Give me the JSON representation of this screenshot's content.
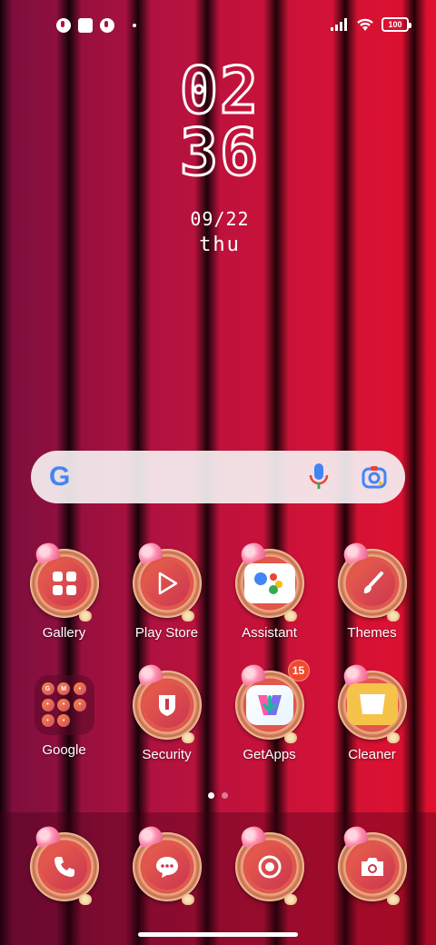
{
  "status_bar": {
    "battery": "100",
    "notification_icons": [
      "app-notification-icon",
      "square-notification-icon",
      "app-notification-icon"
    ],
    "signal_icon": "signal-bars-icon",
    "wifi_icon": "wifi-icon"
  },
  "clock": {
    "hours": "02",
    "minutes": "36",
    "date": "09/22",
    "day": "thu"
  },
  "search": {
    "logo": "G",
    "mic_icon": "microphone-icon",
    "lens_icon": "google-lens-icon"
  },
  "apps_row1": [
    {
      "label": "Gallery",
      "icon": "gallery-grid-icon"
    },
    {
      "label": "Play Store",
      "icon": "play-store-icon"
    },
    {
      "label": "Assistant",
      "icon": "assistant-icon"
    },
    {
      "label": "Themes",
      "icon": "paintbrush-icon"
    }
  ],
  "apps_row2": [
    {
      "label": "Google",
      "icon": "folder-icon"
    },
    {
      "label": "Security",
      "icon": "shield-icon"
    },
    {
      "label": "GetApps",
      "icon": "download-arrow-icon",
      "badge": "15"
    },
    {
      "label": "Cleaner",
      "icon": "trash-bin-icon"
    }
  ],
  "folder_minis": [
    "G",
    "M",
    "•",
    "•",
    "•",
    "•",
    "•",
    "•"
  ],
  "dock": [
    {
      "name": "phone",
      "icon": "phone-icon"
    },
    {
      "name": "messages",
      "icon": "chat-bubble-icon"
    },
    {
      "name": "browser",
      "icon": "chrome-icon"
    },
    {
      "name": "camera",
      "icon": "camera-icon"
    }
  ],
  "page_indicator": {
    "pages": 2,
    "active": 1
  },
  "colors": {
    "accent": "#e0102e",
    "badge": "#f04a2e",
    "frame": "#e0574c"
  }
}
